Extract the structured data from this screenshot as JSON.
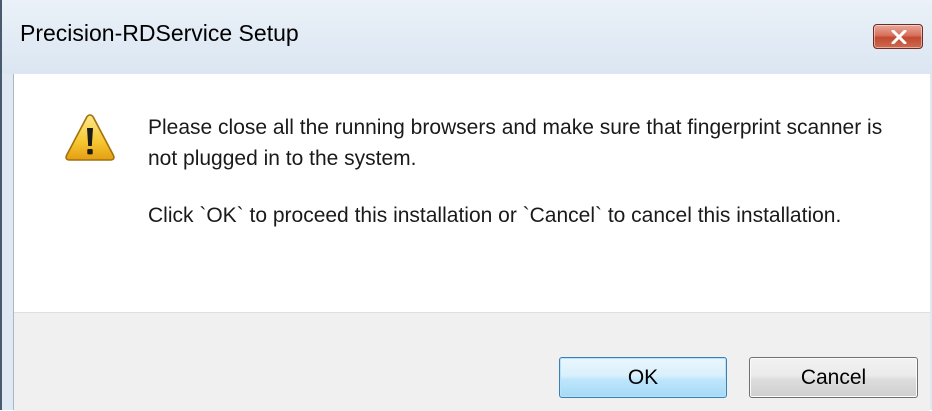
{
  "window": {
    "title": "Precision-RDService Setup",
    "close_icon": "close-x-icon"
  },
  "dialog": {
    "icon": "warning-icon",
    "message_line1": "Please close all the running browsers and make sure that fingerprint scanner is not plugged in to the system.",
    "message_line2": "Click `OK` to proceed this installation or `Cancel` to cancel this installation."
  },
  "buttons": {
    "ok_label": "OK",
    "cancel_label": "Cancel"
  },
  "colors": {
    "close_button": "#c94a30",
    "ok_button_border": "#3c7fb1",
    "warning_fill": "#f7c631"
  }
}
